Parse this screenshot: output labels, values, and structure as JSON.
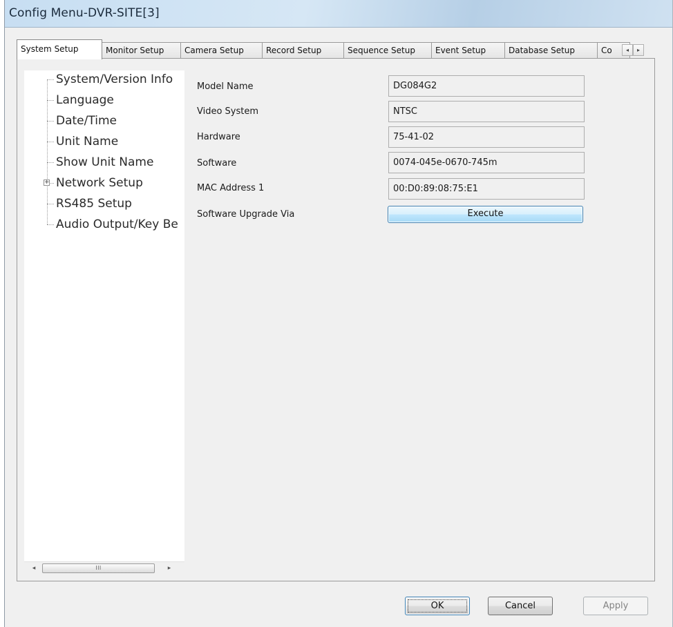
{
  "window": {
    "title": "Config Menu-DVR-SITE[3]"
  },
  "tabs": [
    {
      "label": "System Setup",
      "active": true
    },
    {
      "label": "Monitor Setup",
      "active": false
    },
    {
      "label": "Camera Setup",
      "active": false
    },
    {
      "label": "Record Setup",
      "active": false
    },
    {
      "label": "Sequence Setup",
      "active": false
    },
    {
      "label": "Event Setup",
      "active": false
    },
    {
      "label": "Database Setup",
      "active": false
    },
    {
      "label": "Co",
      "active": false
    }
  ],
  "tab_scroll": {
    "left": "◂",
    "right": "▸"
  },
  "tree": {
    "items": [
      {
        "label": "System/Version Info",
        "selected": true
      },
      {
        "label": "Language"
      },
      {
        "label": "Date/Time"
      },
      {
        "label": "Unit Name"
      },
      {
        "label": "Show Unit Name"
      },
      {
        "label": "Network Setup",
        "expandable": true
      },
      {
        "label": "RS485 Setup"
      },
      {
        "label": "Audio Output/Key Be"
      }
    ],
    "expander_symbol": "+",
    "scrollbar": {
      "left_arrow": "◂",
      "right_arrow": "▸",
      "thumb_grip": "III"
    }
  },
  "info": {
    "fields": [
      {
        "label": "Model Name",
        "value": "DG084G2"
      },
      {
        "label": "Video System",
        "value": "NTSC"
      },
      {
        "label": "Hardware",
        "value": "75-41-02"
      },
      {
        "label": "Software",
        "value": "0074-045e-0670-745m"
      },
      {
        "label": "MAC Address 1",
        "value": "00:D0:89:08:75:E1"
      }
    ],
    "upgrade_label": "Software Upgrade Via",
    "execute_label": "Execute"
  },
  "buttons": {
    "ok": "OK",
    "cancel": "Cancel",
    "apply": "Apply"
  }
}
